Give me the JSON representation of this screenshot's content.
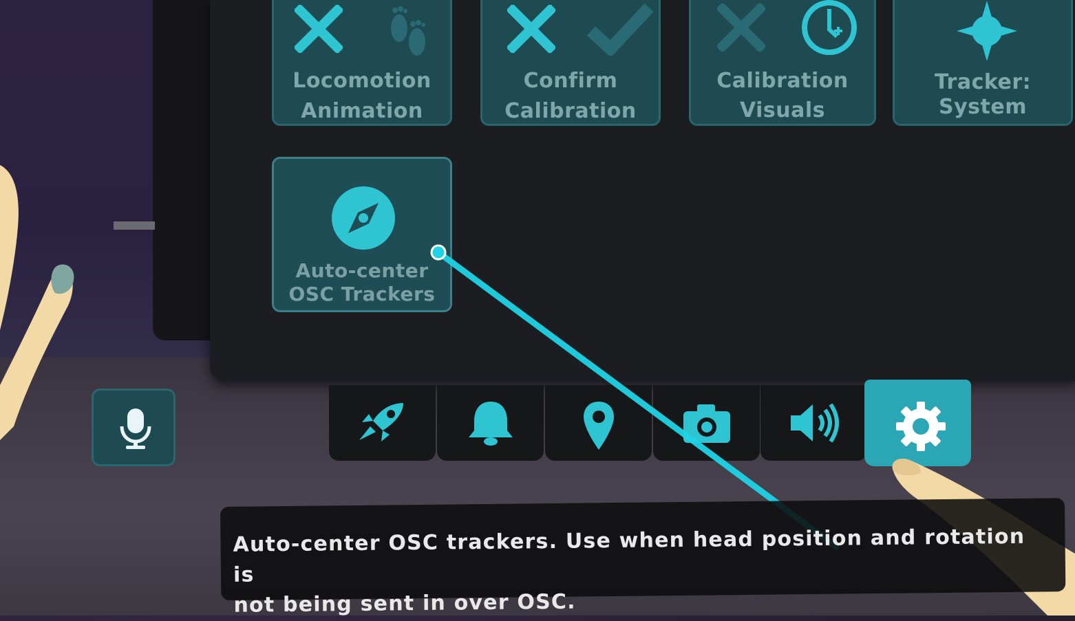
{
  "tiles": [
    {
      "label_line1": "Locomotion",
      "label_line2": "Animation",
      "icons": [
        "x-icon",
        "footprints-icon"
      ]
    },
    {
      "label_line1": "Confirm",
      "label_line2": "Calibration",
      "icons": [
        "x-icon",
        "checkmark-icon"
      ]
    },
    {
      "label_line1": "Calibration",
      "label_line2": "Visuals",
      "icons": [
        "x-icon",
        "clock-icon"
      ]
    },
    {
      "label_line1": "Tracker:",
      "label_line2": "System",
      "icons": [
        "compass-star-icon"
      ]
    },
    {
      "label_line1": "Auto-center",
      "label_line2": "OSC Trackers",
      "icons": [
        "compass-icon"
      ]
    }
  ],
  "tabs": [
    {
      "name": "rocket",
      "icon": "rocket-icon"
    },
    {
      "name": "notifications",
      "icon": "bell-icon"
    },
    {
      "name": "location",
      "icon": "map-pin-icon"
    },
    {
      "name": "camera",
      "icon": "camera-icon"
    },
    {
      "name": "audio",
      "icon": "speaker-icon"
    },
    {
      "name": "settings",
      "icon": "gear-icon",
      "active": true
    }
  ],
  "mic": {
    "icon": "microphone-icon"
  },
  "tooltip": {
    "line1": "Auto-center OSC trackers. Use when head position and rotation is",
    "line2": "not being sent in over OSC."
  },
  "colors": {
    "accent": "#2aa6b4",
    "tile_bg": "#1e4a52",
    "icon": "#2ec4d2",
    "laser": "#1fd3e6"
  }
}
